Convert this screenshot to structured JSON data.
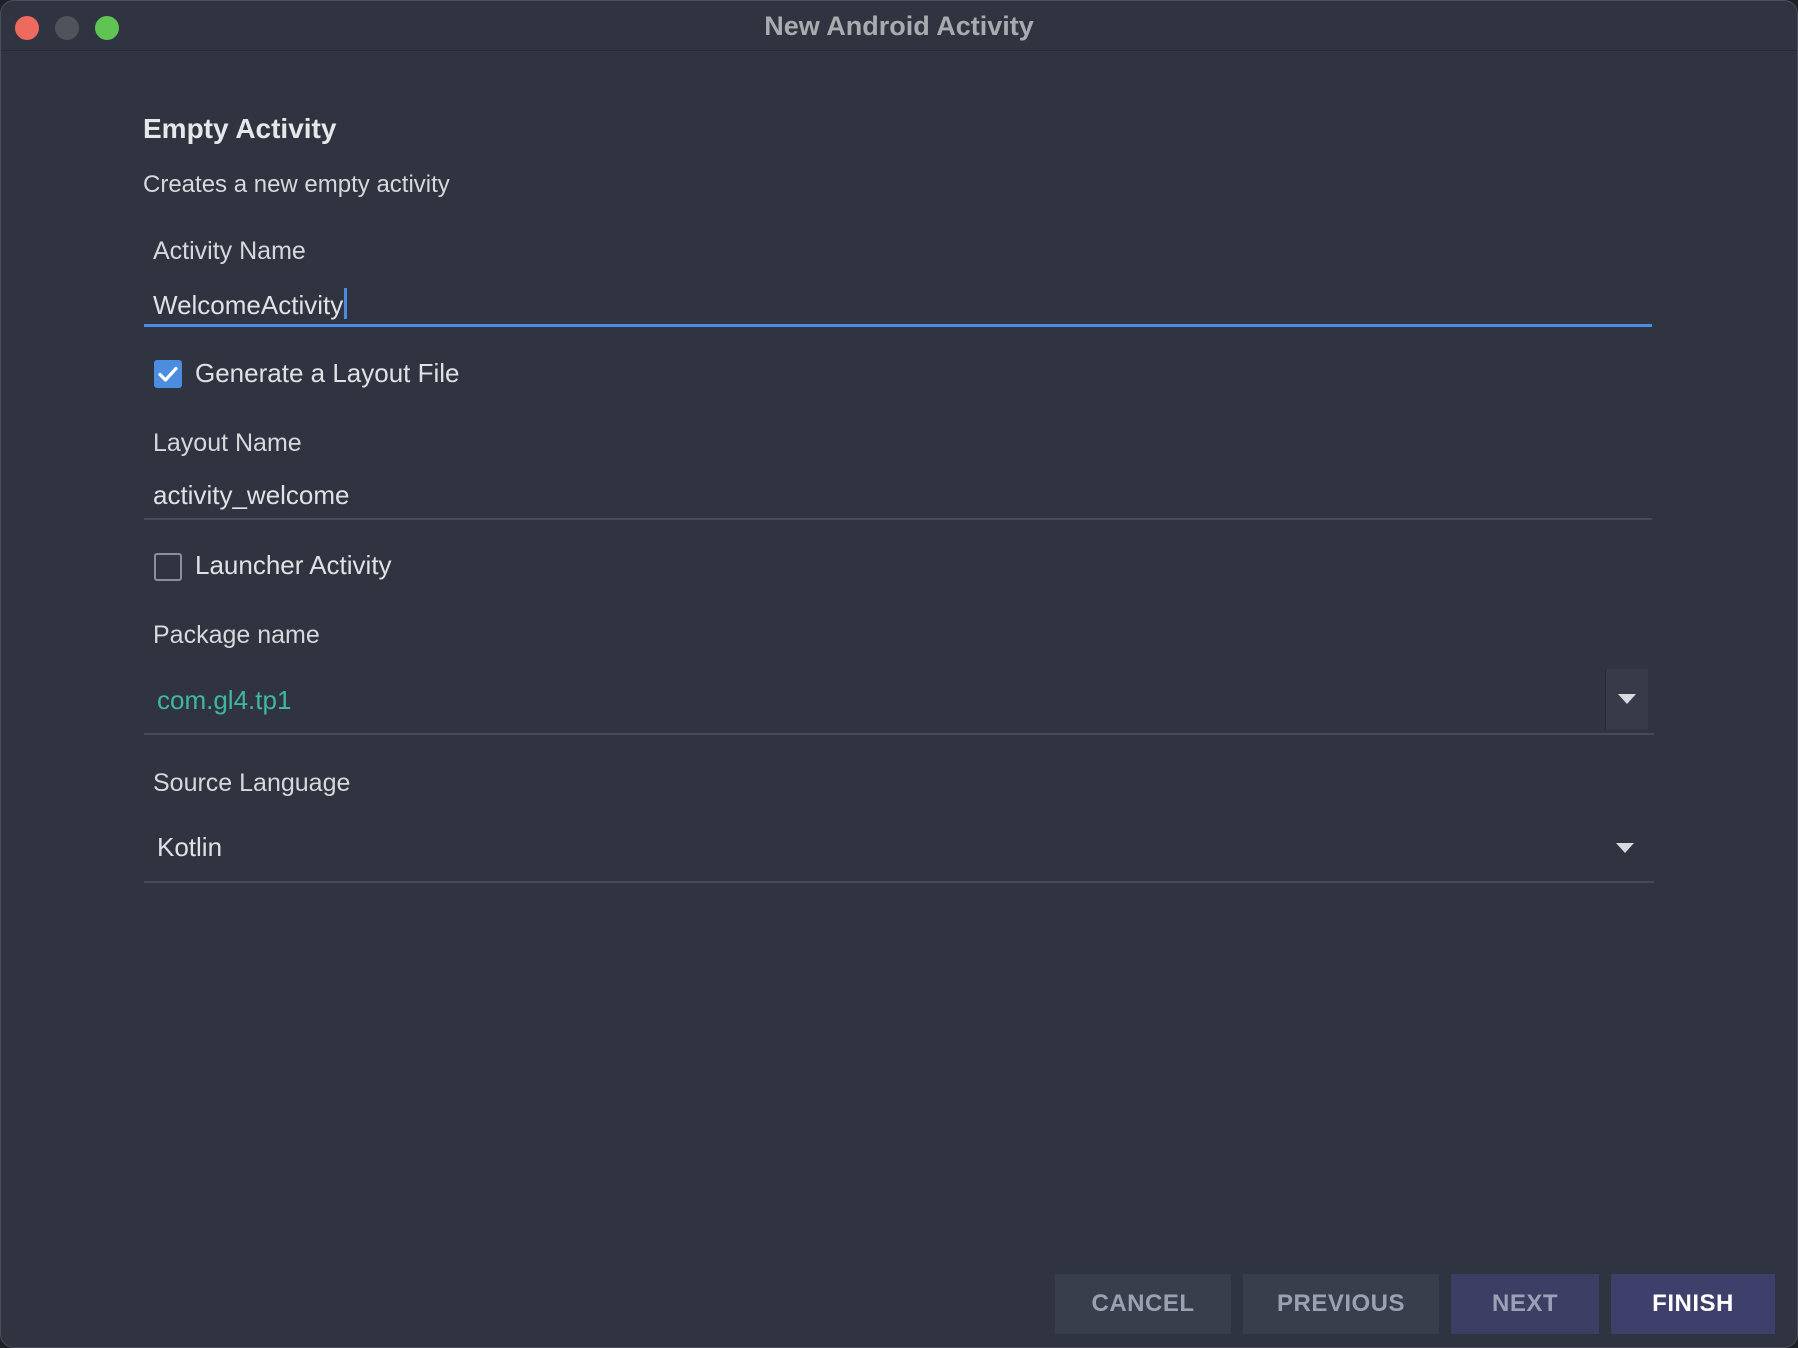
{
  "window": {
    "title": "New Android Activity"
  },
  "template": {
    "heading": "Empty Activity",
    "description": "Creates a new empty activity"
  },
  "form": {
    "activity_name": {
      "label": "Activity Name",
      "value": "WelcomeActivity"
    },
    "generate_layout": {
      "label": "Generate a Layout File",
      "checked": true
    },
    "layout_name": {
      "label": "Layout Name",
      "value": "activity_welcome"
    },
    "launcher_activity": {
      "label": "Launcher Activity",
      "checked": false
    },
    "package_name": {
      "label": "Package name",
      "value": "com.gl4.tp1",
      "color": "#3fb7a3"
    },
    "source_language": {
      "label": "Source Language",
      "value": "Kotlin"
    }
  },
  "buttons": {
    "cancel": "CANCEL",
    "previous": "PREVIOUS",
    "next": "NEXT",
    "finish": "FINISH"
  },
  "colors": {
    "background": "#2f3440",
    "accent": "#4d8be0",
    "package_text": "#3fb7a3"
  },
  "icons": {
    "checkbox_checked": "check-icon",
    "dropdown": "triangle-down-icon"
  }
}
